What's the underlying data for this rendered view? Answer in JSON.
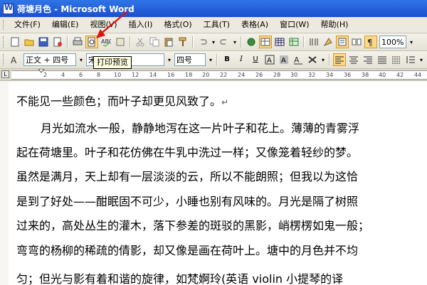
{
  "window": {
    "title": "荷塘月色 - Microsoft Word"
  },
  "menu": {
    "items": [
      "文件(F)",
      "编辑(E)",
      "视图(V)",
      "插入(I)",
      "格式(O)",
      "工具(T)",
      "表格(A)",
      "窗口(W)",
      "帮助(H)"
    ]
  },
  "toolbar": {
    "zoom": "100%",
    "tooltip": "打印预览"
  },
  "format_bar": {
    "style": "正文 + 四号",
    "font": "宋体",
    "size": "四号"
  },
  "ruler": {
    "numbers": [
      "2",
      "4",
      "6",
      "8",
      "10",
      "12",
      "14",
      "16",
      "18",
      "20",
      "22",
      "24",
      "26",
      "28",
      "30",
      "32",
      "34",
      "36",
      "38",
      "40",
      "42",
      "44"
    ]
  },
  "document": {
    "lines": [
      "不能见一些颜色；而叶子却更见风致了。",
      "月光如流水一般，静静地泻在这一片叶子和花上。薄薄的青雾浮",
      "起在荷塘里。叶子和花仿佛在牛乳中洗过一样；又像笼着轻纱的梦。",
      "虽然是满月，天上却有一层淡淡的云，所以不能朗照；但我以为这恰",
      "是到了好处——酣眠固不可少，小睡也别有风味的。月光是隔了树照",
      "过来的，高处丛生的灌木，落下参差的斑驳的黑影，峭楞楞如鬼一般；",
      "弯弯的杨柳的稀疏的倩影，却又像是画在荷叶上。塘中的月色并不均",
      "匀；但光与影有着和谐的旋律，如梵婀玲(英语 violin 小提琴的译"
    ],
    "paragraph_mark": "↵"
  }
}
